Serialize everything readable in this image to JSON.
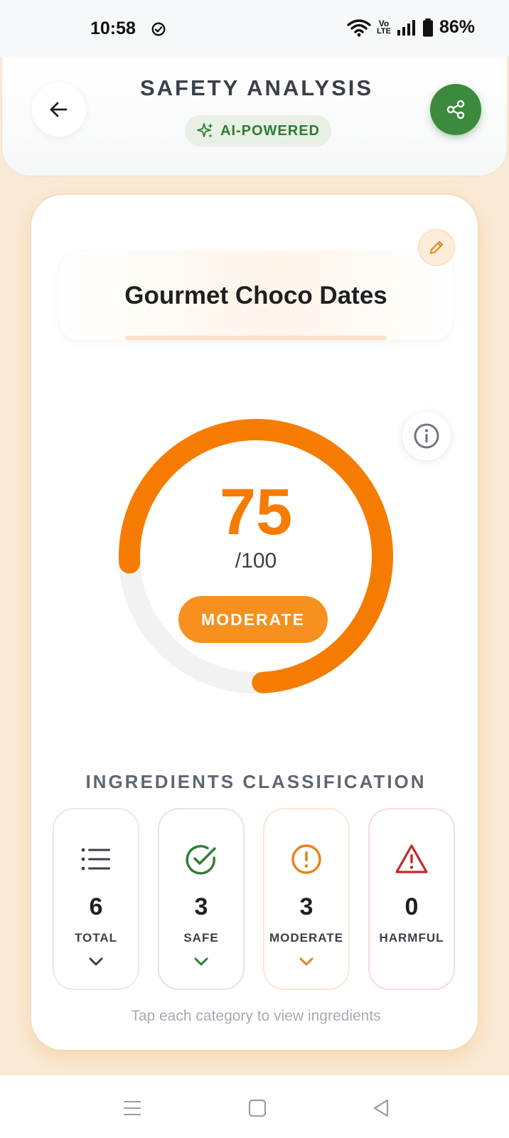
{
  "status_bar": {
    "time": "10:58",
    "battery": "86%",
    "network": "Vo LTE"
  },
  "header": {
    "title": "SAFETY ANALYSIS",
    "badge": "AI-POWERED",
    "back_icon": "arrow-left-icon",
    "share_icon": "share-icon"
  },
  "product": {
    "name": "Gourmet Choco Dates"
  },
  "score": {
    "value": "75",
    "max": "/100",
    "rating": "MODERATE",
    "fraction": 0.75
  },
  "classification": {
    "title": "INGREDIENTS CLASSIFICATION",
    "categories": [
      {
        "label": "TOTAL",
        "count": "6",
        "icon": "list-icon"
      },
      {
        "label": "SAFE",
        "count": "3",
        "icon": "check-circle-icon"
      },
      {
        "label": "MODERATE",
        "count": "3",
        "icon": "alert-circle-icon"
      },
      {
        "label": "HARMFUL",
        "count": "0",
        "icon": "warning-triangle-icon"
      }
    ],
    "hint": "Tap each category to view ingredients"
  },
  "colors": {
    "accent_orange": "#f57c00",
    "safe_green": "#2e7d32",
    "harmful_red": "#c62828",
    "background": "#f9ead6"
  }
}
